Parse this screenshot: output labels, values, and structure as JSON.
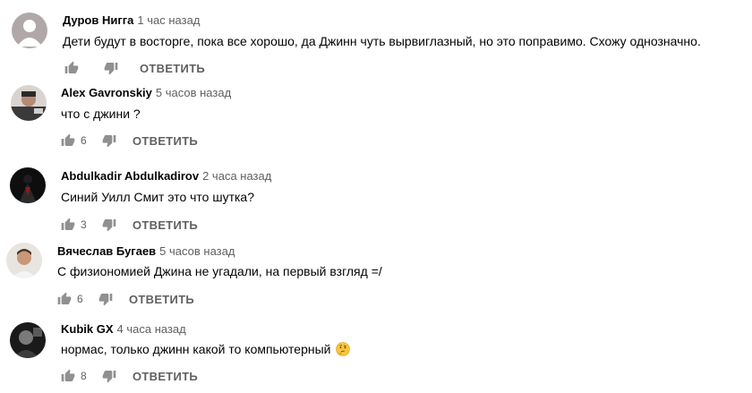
{
  "reply_label": "ОТВЕТИТЬ",
  "comments": [
    {
      "author": "Дуров Нигга",
      "time": "1 час назад",
      "text": "Дети будут в восторге, пока все хорошо, да Джинн чуть вырвиглазный, но это поправимо. Схожу однозначно.",
      "likes": ""
    },
    {
      "author": "Alex Gavronskiy",
      "time": "5 часов назад",
      "text": "что с джини ?",
      "likes": "6"
    },
    {
      "author": "Abdulkadir Abdulkadirov",
      "time": "2 часа назад",
      "text": "Синий Уилл Смит это что шутка?",
      "likes": "3"
    },
    {
      "author": "Вячеслав Бугаев",
      "time": "5 часов назад",
      "text": "С физиономией Джина не угадали, на первый взгляд =/",
      "likes": "6"
    },
    {
      "author": "Kubik GX",
      "time": "4 часа назад",
      "text": "нормас, только джинн какой то компьютерный",
      "likes": "8",
      "emoji": "thinking-face"
    }
  ],
  "colors": {
    "text": "#030303",
    "secondary": "#606060",
    "icon": "#909090"
  }
}
